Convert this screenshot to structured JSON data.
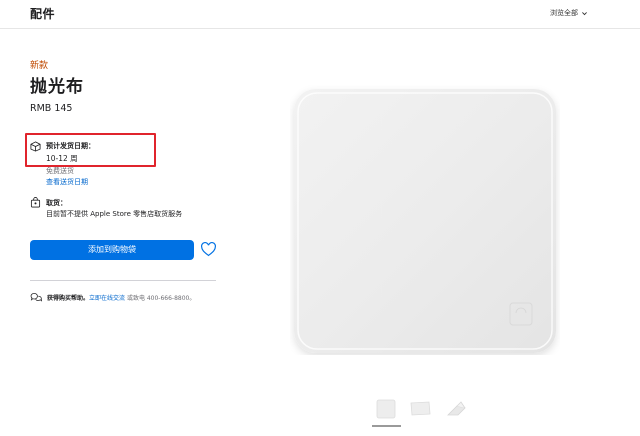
{
  "header": {
    "title": "配件",
    "browse_all": "浏览全部"
  },
  "product": {
    "new_tag": "新款",
    "name": "抛光布",
    "price": "RMB 145"
  },
  "shipping": {
    "label": "预计发货日期：",
    "value": "10-12 周",
    "free": "免费送货",
    "view_dates": "查看送货日期"
  },
  "pickup": {
    "label": "取货：",
    "note": "目前暂不提供 Apple Store 零售店取货服务"
  },
  "actions": {
    "add_to_bag": "添加到购物袋"
  },
  "help": {
    "bold": "获得购买帮助。",
    "link": "立即在线交流",
    "rest": " 或致电 400-666-8800。"
  },
  "icons": {
    "box": "box-icon",
    "store": "store-bag-icon",
    "heart": "heart-icon",
    "chat": "chat-bubbles-icon",
    "chevron": "chevron-down-icon"
  },
  "colors": {
    "accent": "#0071e3",
    "link": "#0066cc",
    "new_tag": "#bf4800",
    "highlight": "#e0242c"
  }
}
